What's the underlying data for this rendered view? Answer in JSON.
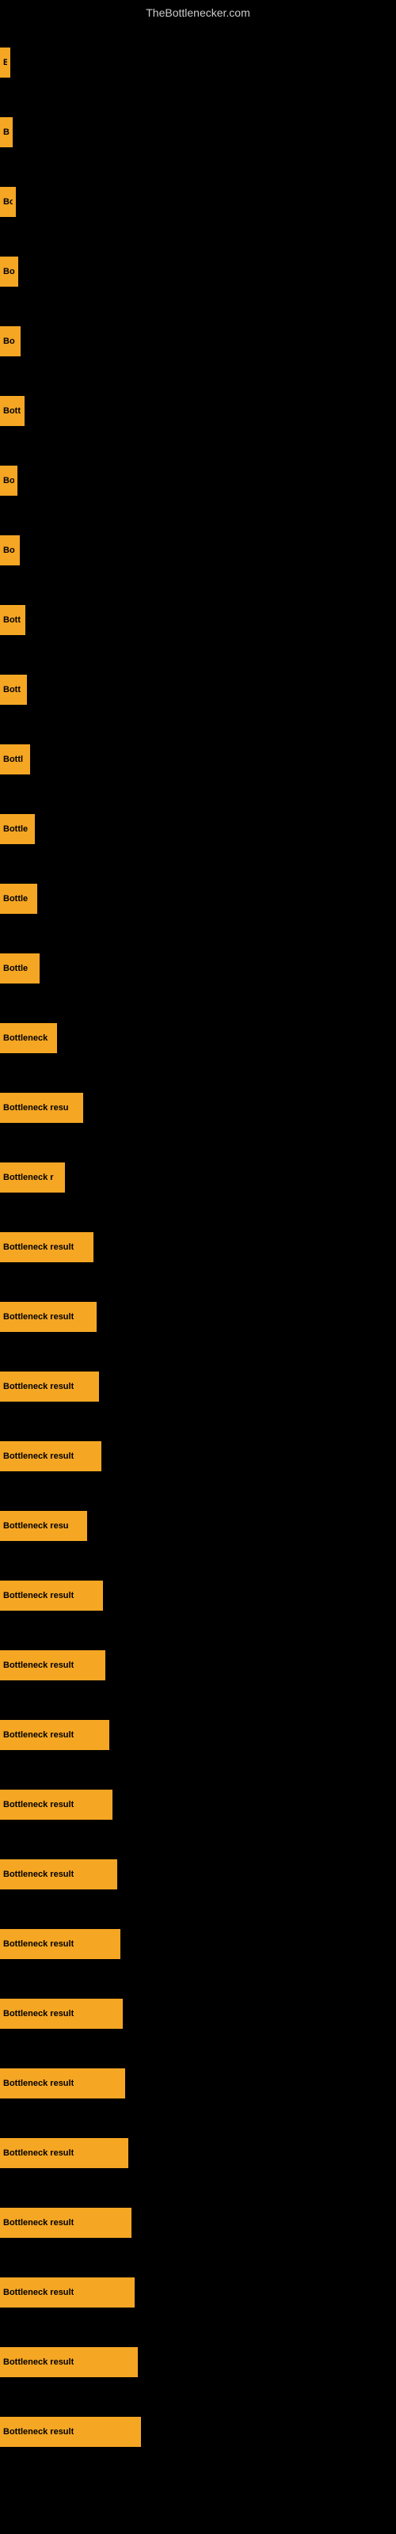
{
  "site_title": "TheBottlenecker.com",
  "bars": [
    {
      "label": "B",
      "width": 13
    },
    {
      "label": "B",
      "width": 16
    },
    {
      "label": "Bo",
      "width": 20
    },
    {
      "label": "Bo",
      "width": 23
    },
    {
      "label": "Bo",
      "width": 26
    },
    {
      "label": "Bott",
      "width": 31
    },
    {
      "label": "Bo",
      "width": 22
    },
    {
      "label": "Bo",
      "width": 25
    },
    {
      "label": "Bott",
      "width": 32
    },
    {
      "label": "Bott",
      "width": 34
    },
    {
      "label": "Bottl",
      "width": 38
    },
    {
      "label": "Bottle",
      "width": 44
    },
    {
      "label": "Bottle",
      "width": 47
    },
    {
      "label": "Bottle",
      "width": 50
    },
    {
      "label": "Bottleneck",
      "width": 72
    },
    {
      "label": "Bottleneck resu",
      "width": 105
    },
    {
      "label": "Bottleneck r",
      "width": 82
    },
    {
      "label": "Bottleneck result",
      "width": 118
    },
    {
      "label": "Bottleneck result",
      "width": 122
    },
    {
      "label": "Bottleneck result",
      "width": 125
    },
    {
      "label": "Bottleneck result",
      "width": 128
    },
    {
      "label": "Bottleneck resu",
      "width": 110
    },
    {
      "label": "Bottleneck result",
      "width": 130
    },
    {
      "label": "Bottleneck result",
      "width": 133
    },
    {
      "label": "Bottleneck result",
      "width": 138
    },
    {
      "label": "Bottleneck result",
      "width": 142
    },
    {
      "label": "Bottleneck result",
      "width": 148
    },
    {
      "label": "Bottleneck result",
      "width": 152
    },
    {
      "label": "Bottleneck result",
      "width": 155
    },
    {
      "label": "Bottleneck result",
      "width": 158
    },
    {
      "label": "Bottleneck result",
      "width": 162
    },
    {
      "label": "Bottleneck result",
      "width": 166
    },
    {
      "label": "Bottleneck result",
      "width": 170
    },
    {
      "label": "Bottleneck result",
      "width": 174
    },
    {
      "label": "Bottleneck result",
      "width": 178
    }
  ]
}
